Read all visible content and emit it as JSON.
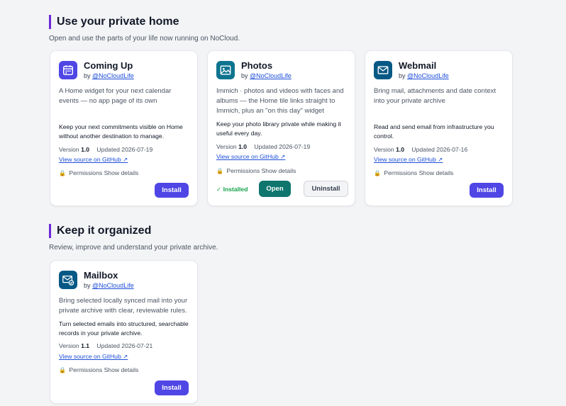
{
  "colors": {
    "accent": "#4f46e5",
    "open": "#0f766e",
    "installed": "#16a34a",
    "section_bar": "#6d28d9"
  },
  "sections": [
    {
      "title": "Use your private home",
      "subtitle": "Open and use the parts of your life now running on NoCloud.",
      "apps": [
        {
          "name": "Coming Up",
          "by": "by",
          "author": "@NoCloudLife",
          "icon": "calendar-icon",
          "icon_color": "#4f46e5",
          "description": "A Home widget for your next calendar events — no app page of its own",
          "purpose": "Keep your next commitments visible on Home without another destination to manage.",
          "version_label": "Version",
          "version": "1.0",
          "updated": "Updated 2026-07-19",
          "source": "View source on GitHub ↗",
          "permissions": "Permissions",
          "details": "Show details",
          "install": "Install"
        },
        {
          "name": "Photos",
          "by": "by",
          "author": "@NoCloudLife",
          "icon": "image-icon",
          "icon_color": "#0e7490",
          "description": "Immich · photos and videos with faces and albums — the Home tile links straight to Immich, plus an \"on this day\" widget",
          "purpose": "Keep your photo library private while making it useful every day.",
          "version_label": "Version",
          "version": "1.0",
          "updated": "Updated 2026-07-19",
          "source": "View source on GitHub ↗",
          "permissions": "Permissions",
          "details": "Show details",
          "installed": "✓ Installed",
          "open": "Open",
          "uninstall": "Uninstall"
        },
        {
          "name": "Webmail",
          "by": "by",
          "author": "@NoCloudLife",
          "icon": "envelope-icon",
          "icon_color": "#075985",
          "description": "Bring mail, attachments and date context into your private archive",
          "purpose": "Read and send email from infrastructure you control.",
          "version_label": "Version",
          "version": "1.0",
          "updated": "Updated 2026-07-16",
          "source": "View source on GitHub ↗",
          "permissions": "Permissions",
          "details": "Show details",
          "install": "Install"
        }
      ]
    },
    {
      "title": "Keep it organized",
      "subtitle": "Review, improve and understand your private archive.",
      "apps": [
        {
          "name": "Mailbox",
          "by": "by",
          "author": "@NoCloudLife",
          "icon": "mail-check-icon",
          "icon_color": "#075985",
          "description": "Bring selected locally synced mail into your private archive with clear, reviewable rules.",
          "purpose": "Turn selected emails into structured, searchable records in your private archive.",
          "version_label": "Version",
          "version": "1.1",
          "updated": "Updated 2026-07-21",
          "source": "View source on GitHub ↗",
          "permissions": "Permissions",
          "details": "Show details",
          "install": "Install"
        }
      ]
    }
  ]
}
